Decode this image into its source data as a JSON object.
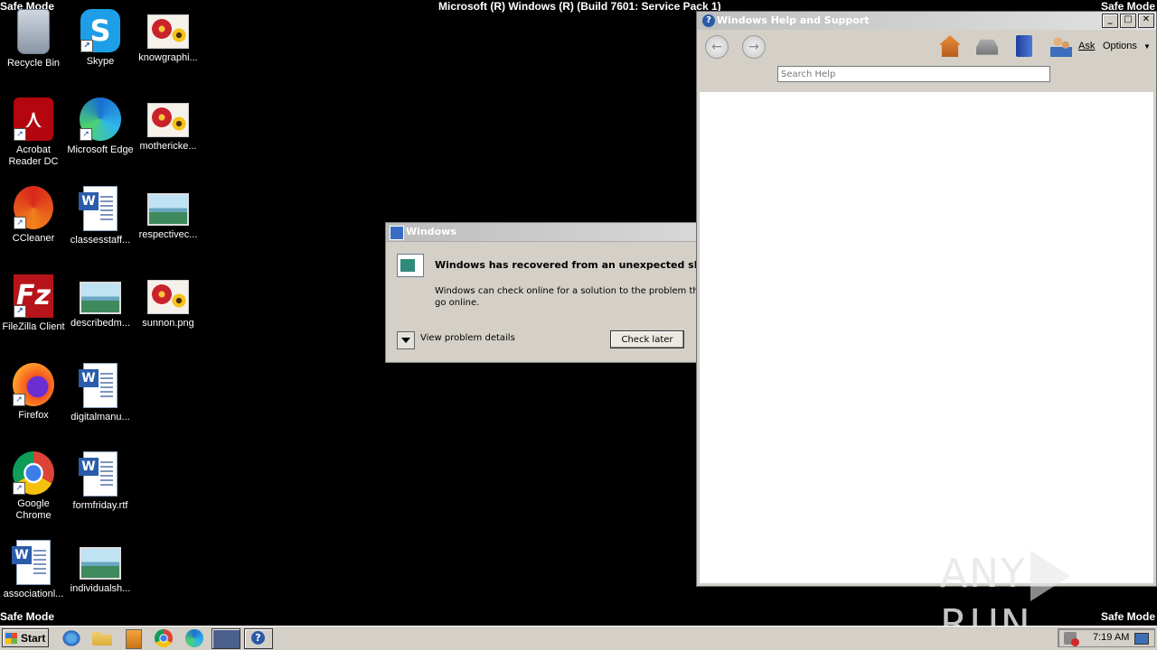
{
  "screen": {
    "safe_mode": "Safe Mode",
    "build": "Microsoft (R) Windows (R) (Build 7601: Service Pack 1)"
  },
  "desktop": {
    "icons": [
      {
        "label": "Recycle Bin",
        "icon": "recycle-bin-icon"
      },
      {
        "label": "Skype",
        "icon": "skype-icon"
      },
      {
        "label": "knowgraphi...",
        "icon": "image-file-icon"
      },
      {
        "label": "Acrobat Reader DC",
        "icon": "acrobat-icon"
      },
      {
        "label": "Microsoft Edge",
        "icon": "edge-icon"
      },
      {
        "label": "mothericke...",
        "icon": "image-file-icon"
      },
      {
        "label": "CCleaner",
        "icon": "ccleaner-icon"
      },
      {
        "label": "classesstaff...",
        "icon": "word-document-icon"
      },
      {
        "label": "respectivec...",
        "icon": "image-file-icon"
      },
      {
        "label": "FileZilla Client",
        "icon": "filezilla-icon"
      },
      {
        "label": "describedm...",
        "icon": "image-file-icon"
      },
      {
        "label": "sunnon.png",
        "icon": "image-file-icon"
      },
      {
        "label": "Firefox",
        "icon": "firefox-icon"
      },
      {
        "label": "digitalmanu...",
        "icon": "word-document-icon"
      },
      {
        "label": "Google Chrome",
        "icon": "chrome-icon"
      },
      {
        "label": "formfriday.rtf",
        "icon": "word-document-icon"
      },
      {
        "label": "associationl...",
        "icon": "word-document-icon"
      },
      {
        "label": "individualsh...",
        "icon": "image-file-icon"
      }
    ]
  },
  "dialog": {
    "title": "Windows",
    "heading": "Windows has recovered from an unexpected shutdc",
    "body_line1": "Windows can check online for a solution to the problem the r",
    "body_line2": "go online.",
    "details_label": "View problem details",
    "button_label": "Check later"
  },
  "help_window": {
    "title": "Windows Help and Support",
    "ask_label": "Ask",
    "options_label": "Options",
    "search_placeholder": "Search Help",
    "search_value": ""
  },
  "watermark": {
    "left": "ANY",
    "right": "RUN"
  },
  "taskbar": {
    "start_label": "Start",
    "clock": "7:19 AM"
  }
}
